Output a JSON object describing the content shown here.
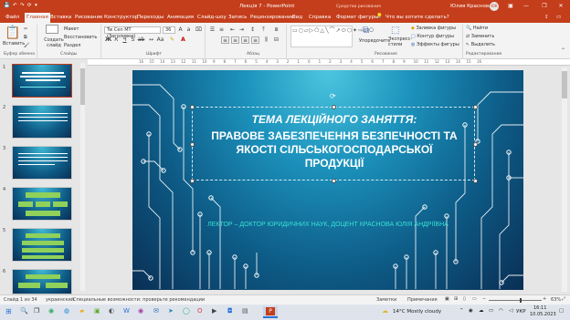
{
  "titlebar": {
    "autosave_glyphs": [
      "💾",
      "↶",
      "↷",
      "⟳",
      "▾"
    ],
    "doc_title": "Лекція 7 - PowerPoint",
    "user_name": "Юлия Краснова",
    "user_initials": "ЮК"
  },
  "tabs": [
    {
      "label": "Файл",
      "active": false
    },
    {
      "label": "Главная",
      "active": true
    },
    {
      "label": "Вставка",
      "active": false
    },
    {
      "label": "Рисование",
      "active": false
    },
    {
      "label": "Конструктор",
      "active": false
    },
    {
      "label": "Переходы",
      "active": false
    },
    {
      "label": "Анимация",
      "active": false
    },
    {
      "label": "Слайд-шоу",
      "active": false
    },
    {
      "label": "Запись",
      "active": false
    },
    {
      "label": "Рецензирование",
      "active": false
    },
    {
      "label": "Вид",
      "active": false
    },
    {
      "label": "Справка",
      "active": false
    },
    {
      "label": "Формат фигуры",
      "active": false
    }
  ],
  "context_label": "Средства рисования",
  "tell_me": "Что вы хотите сделать?",
  "ribbon": {
    "paste": "Вставить",
    "cut": "Вырезать",
    "copy": "Копировать",
    "format_painter": "Формат",
    "new_slide": "Создать слайд",
    "layout": "Макет",
    "reset": "Восстановить",
    "section": "Раздел",
    "font_name": "Tw Cen MT (Заголовки)",
    "font_size": "36",
    "arrange": "Упорядочить",
    "quick_styles": "Экспресс-стили",
    "shape_fill": "Заливка фигуры",
    "shape_outline": "Контур фигуры",
    "shape_effects": "Эффекты фигуры",
    "find": "Найти",
    "replace": "Заменить",
    "select": "Выделить",
    "group_labels": [
      "Буфер обмена",
      "Слайды",
      "Шрифт",
      "Абзац",
      "Рисование",
      "Редактирование"
    ]
  },
  "ruler_ticks": [
    "16",
    "15",
    "14",
    "13",
    "12",
    "11",
    "10",
    "9",
    "8",
    "7",
    "6",
    "5",
    "4",
    "3",
    "2",
    "1",
    "0",
    "1",
    "2",
    "3",
    "4",
    "5",
    "6",
    "7",
    "8",
    "9",
    "10",
    "11",
    "12",
    "13",
    "14",
    "15",
    "16"
  ],
  "thumbnails": [
    {
      "num": "1",
      "active": true
    },
    {
      "num": "2",
      "active": false
    },
    {
      "num": "3",
      "active": false
    },
    {
      "num": "4",
      "active": false
    },
    {
      "num": "5",
      "active": false
    },
    {
      "num": "6",
      "active": false
    }
  ],
  "slide": {
    "title_line1": "ТЕМА ЛЕКЦІЙНОГО ЗАНЯТТЯ:",
    "title_line2": "ПРАВОВЕ ЗАБЕЗПЕЧЕННЯ БЕЗПЕЧНОСТІ ТА",
    "title_line3": "ЯКОСТІ СІЛЬСЬКОГОСПОДАРСЬКОЇ",
    "title_line4": "ПРОДУКЦІЇ",
    "subtitle": "ЛЕКТОР – ДОКТОР ЮРИДИЧНИХ НАУК, ДОЦЕНТ КРАСНОВА ЮЛІЯ АНДРІЇВНА"
  },
  "status": {
    "slide_counter": "Слайд 1 из 34",
    "language": "украинский",
    "accessibility": "Специальные возможности: проверьте рекомендации",
    "notes": "Заметки",
    "comments": "Примечания",
    "zoom": "63%"
  },
  "taskbar": {
    "weather": "14°C  Mostly cloudy",
    "lang": "УКР",
    "time": "16:11",
    "date": "10.05.2023"
  },
  "colors": {
    "ppt_red": "#c43e1c",
    "slide_accent": "#38e0d5"
  }
}
